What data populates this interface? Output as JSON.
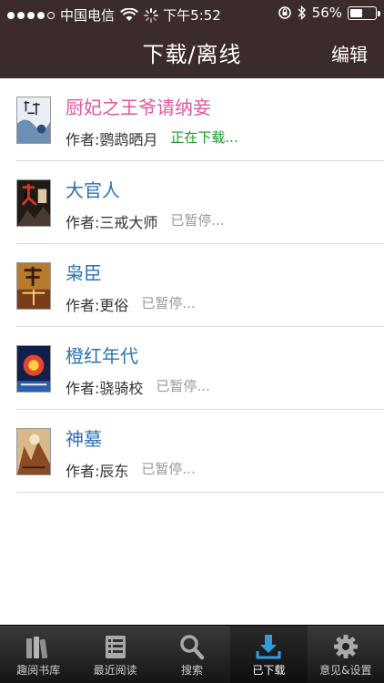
{
  "status_bar": {
    "carrier": "中国电信",
    "time": "下午5:52",
    "battery": "56%",
    "battery_level": 0.56
  },
  "nav": {
    "title": "下载/离线",
    "edit_label": "编辑"
  },
  "books": [
    {
      "title": "厨妃之王爷请纳妾",
      "author": "作者:鹦鹉晒月",
      "status": "正在下载...",
      "active": true
    },
    {
      "title": "大官人",
      "author": "作者:三戒大师",
      "status": "已暂停...",
      "active": false
    },
    {
      "title": "枭臣",
      "author": "作者:更俗",
      "status": "已暂停...",
      "active": false
    },
    {
      "title": "橙红年代",
      "author": "作者:骁骑校",
      "status": "已暂停...",
      "active": false
    },
    {
      "title": "神墓",
      "author": "作者:辰东",
      "status": "已暂停...",
      "active": false
    }
  ],
  "tabs": [
    {
      "label": "趣阅书库",
      "icon": "bookshelf-icon"
    },
    {
      "label": "最近阅读",
      "icon": "recent-list-icon"
    },
    {
      "label": "搜索",
      "icon": "magnifier-icon"
    },
    {
      "label": "已下载",
      "icon": "download-icon",
      "active": true
    },
    {
      "label": "意见&设置",
      "icon": "gear-icon"
    }
  ],
  "colors": {
    "nav_bg": "#3b2b2a",
    "title_blue": "#2b72b6",
    "title_pink": "#e0589a",
    "downloading_green": "#1a9a2a",
    "tab_active_accent": "#2f9be0"
  }
}
